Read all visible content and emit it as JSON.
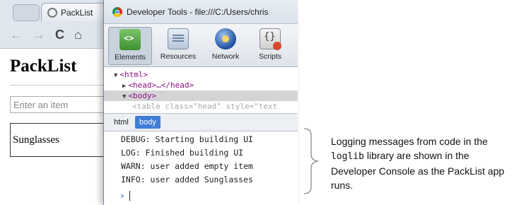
{
  "left_browser": {
    "tab_title": "PackList",
    "nav": {
      "back": "←",
      "forward": "→",
      "reload": "C",
      "home": "⌂"
    },
    "app_title": "PackList",
    "input_placeholder": "Enter an item",
    "list_items": [
      "Sunglasses"
    ]
  },
  "devtools": {
    "window_title": "Developer Tools - file:///C:/Users/chris",
    "tools": [
      {
        "label": "Elements",
        "icon": "elements-icon",
        "active": true
      },
      {
        "label": "Resources",
        "icon": "resources-icon",
        "active": false
      },
      {
        "label": "Network",
        "icon": "network-icon",
        "active": false
      },
      {
        "label": "Scripts",
        "icon": "scripts-icon",
        "active": false
      }
    ],
    "dom_tree": [
      {
        "arrow": "▼",
        "text": "<html>"
      },
      {
        "arrow": "▶",
        "text": "<head>…</head>"
      },
      {
        "arrow": "▼",
        "text": "<body>"
      },
      {
        "arrow": "",
        "text": "<table class=\"head\" style=\"text"
      }
    ],
    "breadcrumbs": [
      "html",
      "body"
    ],
    "console_lines": [
      "DEBUG: Starting building UI",
      "LOG: Finished building UI",
      "WARN: user added empty item",
      "INFO: user added Sunglasses"
    ],
    "console_prompt": "›"
  },
  "callout": {
    "text_before": "Logging messages from code in the ",
    "code": "loglib",
    "text_after": " library are shown in the Developer Console as the PackList app runs."
  }
}
